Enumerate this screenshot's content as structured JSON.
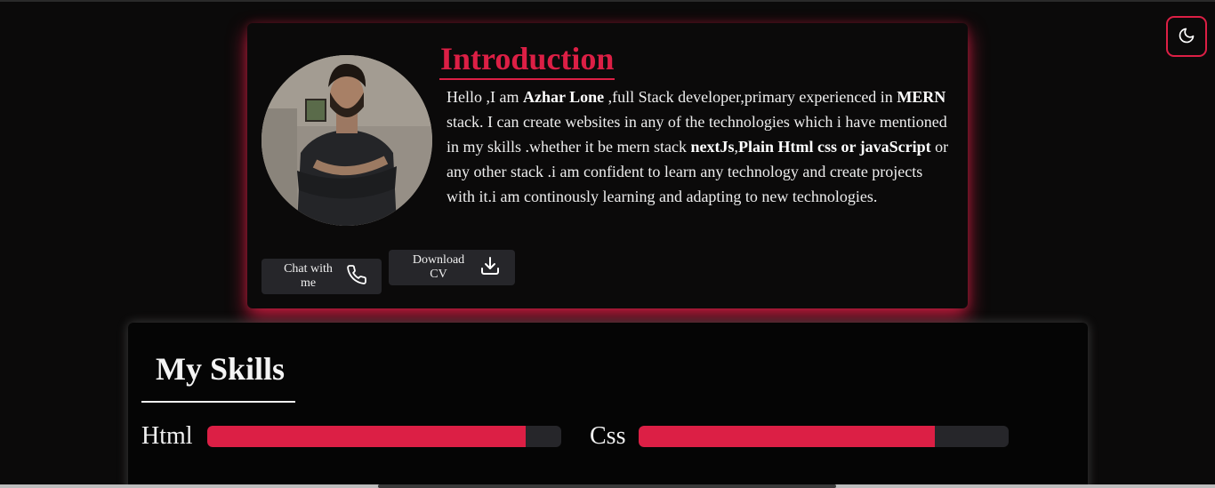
{
  "theme_toggle": {
    "icon": "moon-icon"
  },
  "intro": {
    "title": "Introduction",
    "text": [
      {
        "t": "Hello ,I am ",
        "b": false
      },
      {
        "t": "Azhar Lone",
        "b": true
      },
      {
        "t": " ,full Stack developer,primary experienced in ",
        "b": false
      },
      {
        "t": "MERN",
        "b": true
      },
      {
        "t": " stack. I can create websites in any of the technologies which i have mentioned in my skills .whether it be mern stack ",
        "b": false
      },
      {
        "t": "nextJs",
        "b": true
      },
      {
        "t": ",",
        "b": false
      },
      {
        "t": "Plain Html css or javaScript",
        "b": true
      },
      {
        "t": " or any other stack .i am confident to learn any technology and create projects with it.i am continously learning and adapting to new technologies.",
        "b": false
      }
    ],
    "chat_button": "Chat with me",
    "cv_button": "Download CV"
  },
  "skills": {
    "title": "My Skills",
    "items": [
      {
        "name": "Html",
        "level": 0.9
      },
      {
        "name": "Css",
        "level": 0.8
      }
    ]
  },
  "colors": {
    "accent": "#dc1f45",
    "background": "#0b0a0a",
    "button": "#26262a"
  }
}
